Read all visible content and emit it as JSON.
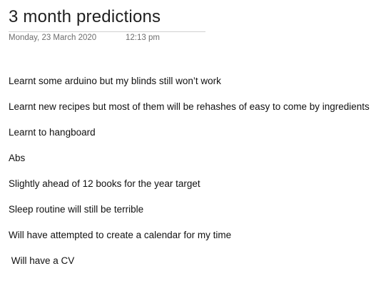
{
  "page": {
    "title": "3 month predictions",
    "date": "Monday, 23 March 2020",
    "time": "12:13 pm"
  },
  "note": {
    "lines": [
      "Learnt some arduino but my blinds still won’t work",
      "Learnt new recipes but most of them will be rehashes of easy to come by ingredients",
      "Learnt to hangboard",
      "Abs",
      "Slightly ahead of 12 books for the year target",
      "Sleep routine will still be terrible",
      "Will have attempted to create a calendar for my time",
      " Will have a CV"
    ]
  }
}
